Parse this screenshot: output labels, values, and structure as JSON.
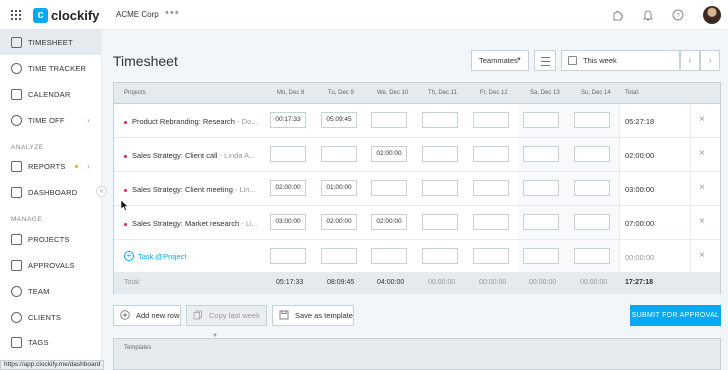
{
  "topbar": {
    "brand": "clockify",
    "workspace": "ACME Corp",
    "more": "•••",
    "icons": [
      "apps-grid-icon",
      "puzzle-icon",
      "bell-icon",
      "help-icon"
    ]
  },
  "sidebar": {
    "items": [
      {
        "label": "TIMESHEET",
        "icon": "timesheet-icon",
        "active": true
      },
      {
        "label": "TIME TRACKER",
        "icon": "clock-icon"
      },
      {
        "label": "CALENDAR",
        "icon": "calendar-icon"
      },
      {
        "label": "TIME OFF",
        "icon": "time-off-icon",
        "chevron": "›"
      }
    ],
    "analyze_label": "ANALYZE",
    "analyze_items": [
      {
        "label": "REPORTS",
        "icon": "reports-icon",
        "chevron": "›"
      },
      {
        "label": "DASHBOARD",
        "icon": "dashboard-icon"
      }
    ],
    "manage_label": "MANAGE",
    "manage_items": [
      {
        "label": "PROJECTS",
        "icon": "projects-icon"
      },
      {
        "label": "APPROVALS",
        "icon": "approvals-icon"
      },
      {
        "label": "TEAM",
        "icon": "team-icon"
      },
      {
        "label": "CLIENTS",
        "icon": "clients-icon"
      },
      {
        "label": "TAGS",
        "icon": "tags-icon"
      }
    ],
    "collapse": "«"
  },
  "status_url": "https://app.clockify.me/dashboard",
  "header": {
    "title": "Timesheet",
    "teammates": "Teammates",
    "week": "This week",
    "prev": "‹",
    "next": "›"
  },
  "table": {
    "columns": [
      "Projects",
      "Mo, Dec 8",
      "Tu, Dec 9",
      "We, Dec 10",
      "Th, Dec 11",
      "Fr, Dec 12",
      "Sa, Dec 13",
      "Su, Dec 14",
      "Total:"
    ],
    "rows": [
      {
        "project": "Product Rebranding: Research",
        "client": "- Do...",
        "color": "#e91e63",
        "cells": [
          "00:17:33",
          "05:09:45",
          "",
          "",
          "",
          "",
          ""
        ],
        "total": "05:27:18"
      },
      {
        "project": "Sales Strategy: Client call",
        "client": "- Linda A...",
        "color": "#e91e63",
        "cells": [
          "",
          "",
          "02:00:00",
          "",
          "",
          "",
          ""
        ],
        "total": "02:00:00"
      },
      {
        "project": "Sales Strategy: Client meeting",
        "client": "- Lin...",
        "color": "#e91e63",
        "cells": [
          "02:00:00",
          "01:00:00",
          "",
          "",
          "",
          "",
          ""
        ],
        "total": "03:00:00"
      },
      {
        "project": "Sales Strategy: Market research",
        "client": "- Li...",
        "color": "#e91e63",
        "cells": [
          "03:00:00",
          "02:00:00",
          "02:00:00",
          "",
          "",
          "",
          ""
        ],
        "total": "07:00:00"
      }
    ],
    "add_row": {
      "label": "Task @Project",
      "total": "00:00:00"
    },
    "footer": {
      "label": "Total:",
      "values": [
        "05:17:33",
        "08:09:45",
        "04:00:00",
        "00:00:00",
        "00:00:00",
        "00:00:00",
        "00:00:00"
      ],
      "grand_total": "17:27:18"
    },
    "remove": "×"
  },
  "actions": {
    "add_new_row": "Add new row",
    "copy_last_week": "Copy last week",
    "save_template": "Save as template",
    "submit": "SUBMIT FOR APPROVAL"
  },
  "templates_label": "Templates",
  "colors": {
    "accent": "#03a9f4",
    "project_dot": "#e91e63"
  }
}
